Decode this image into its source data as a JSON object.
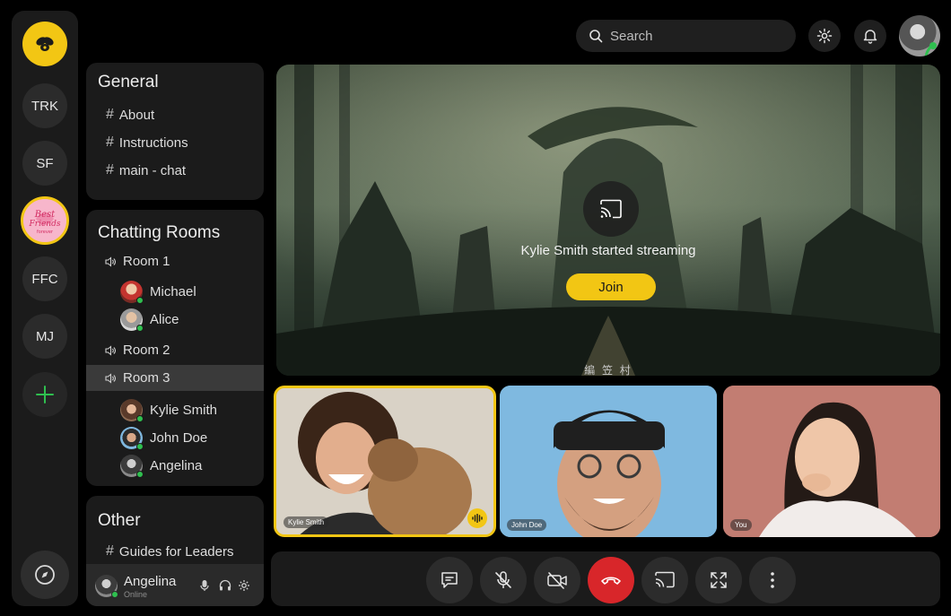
{
  "rail": {
    "servers": [
      {
        "label": "TRK"
      },
      {
        "label": "SF"
      },
      {
        "label": "FFC"
      },
      {
        "label": "MJ"
      }
    ],
    "favorite_logo_text": "Best Friends Forever"
  },
  "general": {
    "title": "General",
    "channels": [
      "About",
      "Instructions",
      "main - chat"
    ]
  },
  "chatting_rooms": {
    "title": "Chatting Rooms",
    "room1": {
      "label": "Room 1",
      "members": [
        "Michael",
        "Alice"
      ]
    },
    "room2": {
      "label": "Room 2"
    },
    "room3": {
      "label": "Room 3",
      "members": [
        "Kylie Smith",
        "John Doe",
        "Angelina"
      ]
    }
  },
  "other": {
    "title": "Other",
    "channels": [
      "Guides for Leaders"
    ]
  },
  "user": {
    "name": "Angelina",
    "status": "Online"
  },
  "header": {
    "search_placeholder": "Search"
  },
  "stream": {
    "message": "Kylie Smith started streaming",
    "join_label": "Join",
    "caption": "編 笠 村"
  },
  "tiles": [
    {
      "name": "Kylie Smith",
      "speaking": true
    },
    {
      "name": "John Doe",
      "speaking": false
    },
    {
      "name": "You",
      "speaking": false
    }
  ],
  "colors": {
    "accent": "#f2c614",
    "hangup": "#d8262a",
    "online": "#2fbf4f",
    "panel": "#1b1b1b"
  }
}
